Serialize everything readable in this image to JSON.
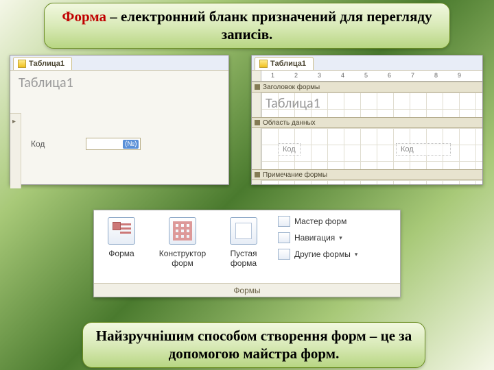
{
  "title": {
    "highlight": "Форма",
    "rest": " – електронний бланк призначений для перегляду записів."
  },
  "bottom_note": "Найзручнішим способом створення форм – це за допомогою майстра форм.",
  "form_view": {
    "tab_label": "Таблица1",
    "title": "Таблица1",
    "field_label": "Код",
    "new_badge": "(№)"
  },
  "design_view": {
    "tab_label": "Таблица1",
    "ruler_marks": [
      "1",
      "2",
      "3",
      "4",
      "5",
      "6",
      "7",
      "8",
      "9"
    ],
    "section_header": "Заголовок формы",
    "section_detail": "Область данных",
    "section_footer": "Примечание формы",
    "title_ctl": "Таблица1",
    "label_ctl": "Код",
    "field_ctl": "Код"
  },
  "ribbon": {
    "big": [
      {
        "label": "Форма"
      },
      {
        "label": "Конструктор форм"
      },
      {
        "label": "Пустая форма"
      }
    ],
    "side": [
      {
        "label": "Мастер форм",
        "dropdown": false
      },
      {
        "label": "Навигация",
        "dropdown": true
      },
      {
        "label": "Другие формы",
        "dropdown": true
      }
    ],
    "group_caption": "Формы"
  }
}
